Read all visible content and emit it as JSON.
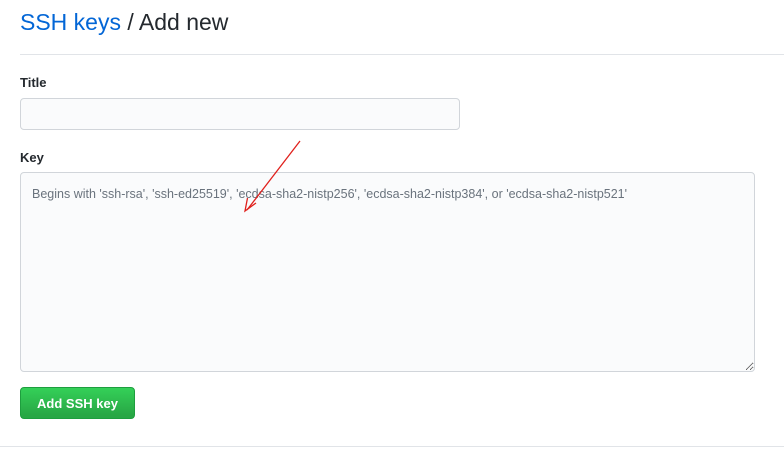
{
  "header": {
    "breadcrumb_link": "SSH keys",
    "separator": "/",
    "current_page": "Add new"
  },
  "form": {
    "title_label": "Title",
    "title_value": "",
    "key_label": "Key",
    "key_value": "",
    "key_placeholder": "Begins with 'ssh-rsa', 'ssh-ed25519', 'ecdsa-sha2-nistp256', 'ecdsa-sha2-nistp384', or 'ecdsa-sha2-nistp521'",
    "submit_label": "Add SSH key"
  },
  "colors": {
    "link": "#0366d6",
    "primary_button": "#28a745",
    "annotation_arrow": "#e0201c"
  }
}
